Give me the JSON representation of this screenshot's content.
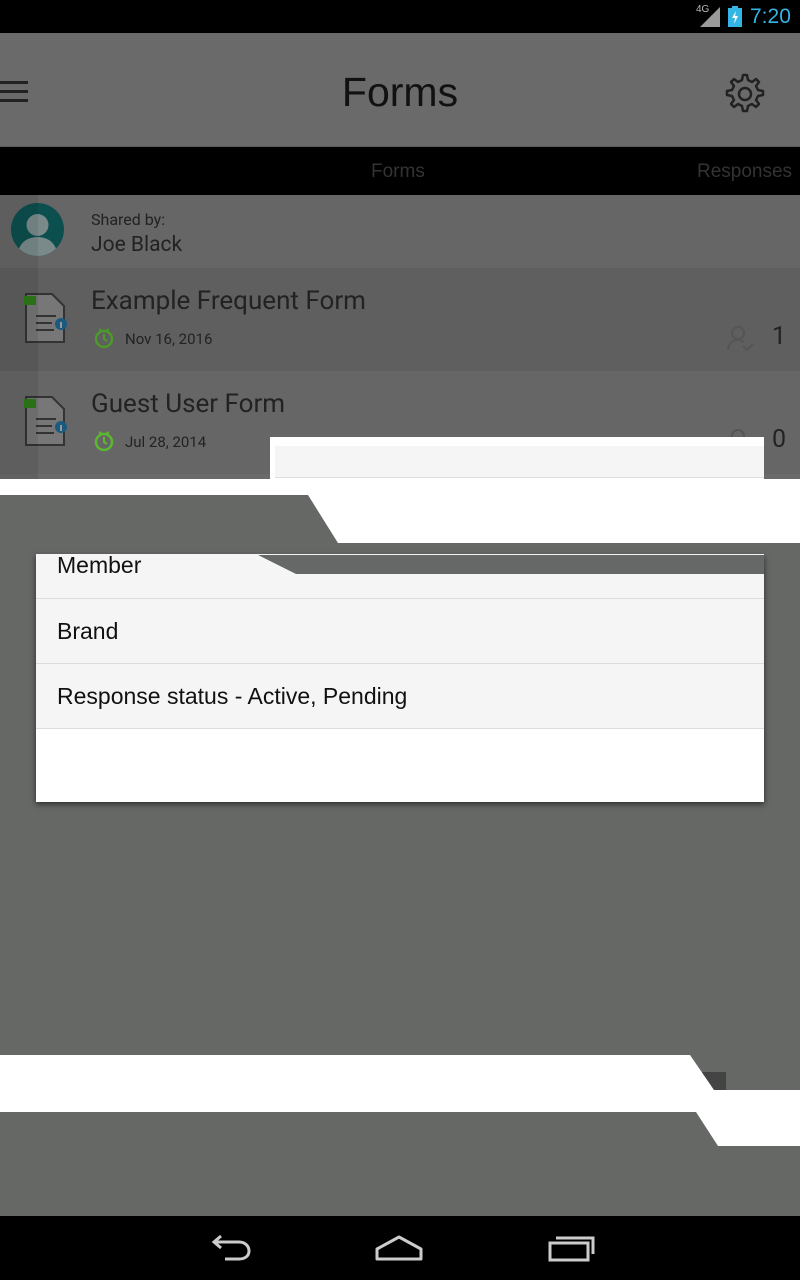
{
  "status_bar": {
    "network": "4G",
    "time": "7:20"
  },
  "app_bar": {
    "title": "Forms",
    "menu_icon": "hamburger-menu-icon",
    "settings_icon": "gear-icon"
  },
  "tabs": [
    {
      "label": "Forms"
    },
    {
      "label": "Responses"
    }
  ],
  "shared": {
    "label": "Shared by:",
    "name": "Joe Black"
  },
  "forms": [
    {
      "title": "Example Frequent Form",
      "date": "Nov 16, 2016",
      "count": "1"
    },
    {
      "title": "Guest User Form",
      "date": "Jul 28, 2014",
      "count": "0"
    }
  ],
  "dialog": {
    "items": [
      {
        "label": "Member"
      },
      {
        "label": "Brand"
      },
      {
        "label": "Response status - Active, Pending"
      }
    ]
  },
  "colors": {
    "accent": "#33b5e5",
    "overlay": "#666868",
    "form_green": "#5cb82f"
  }
}
